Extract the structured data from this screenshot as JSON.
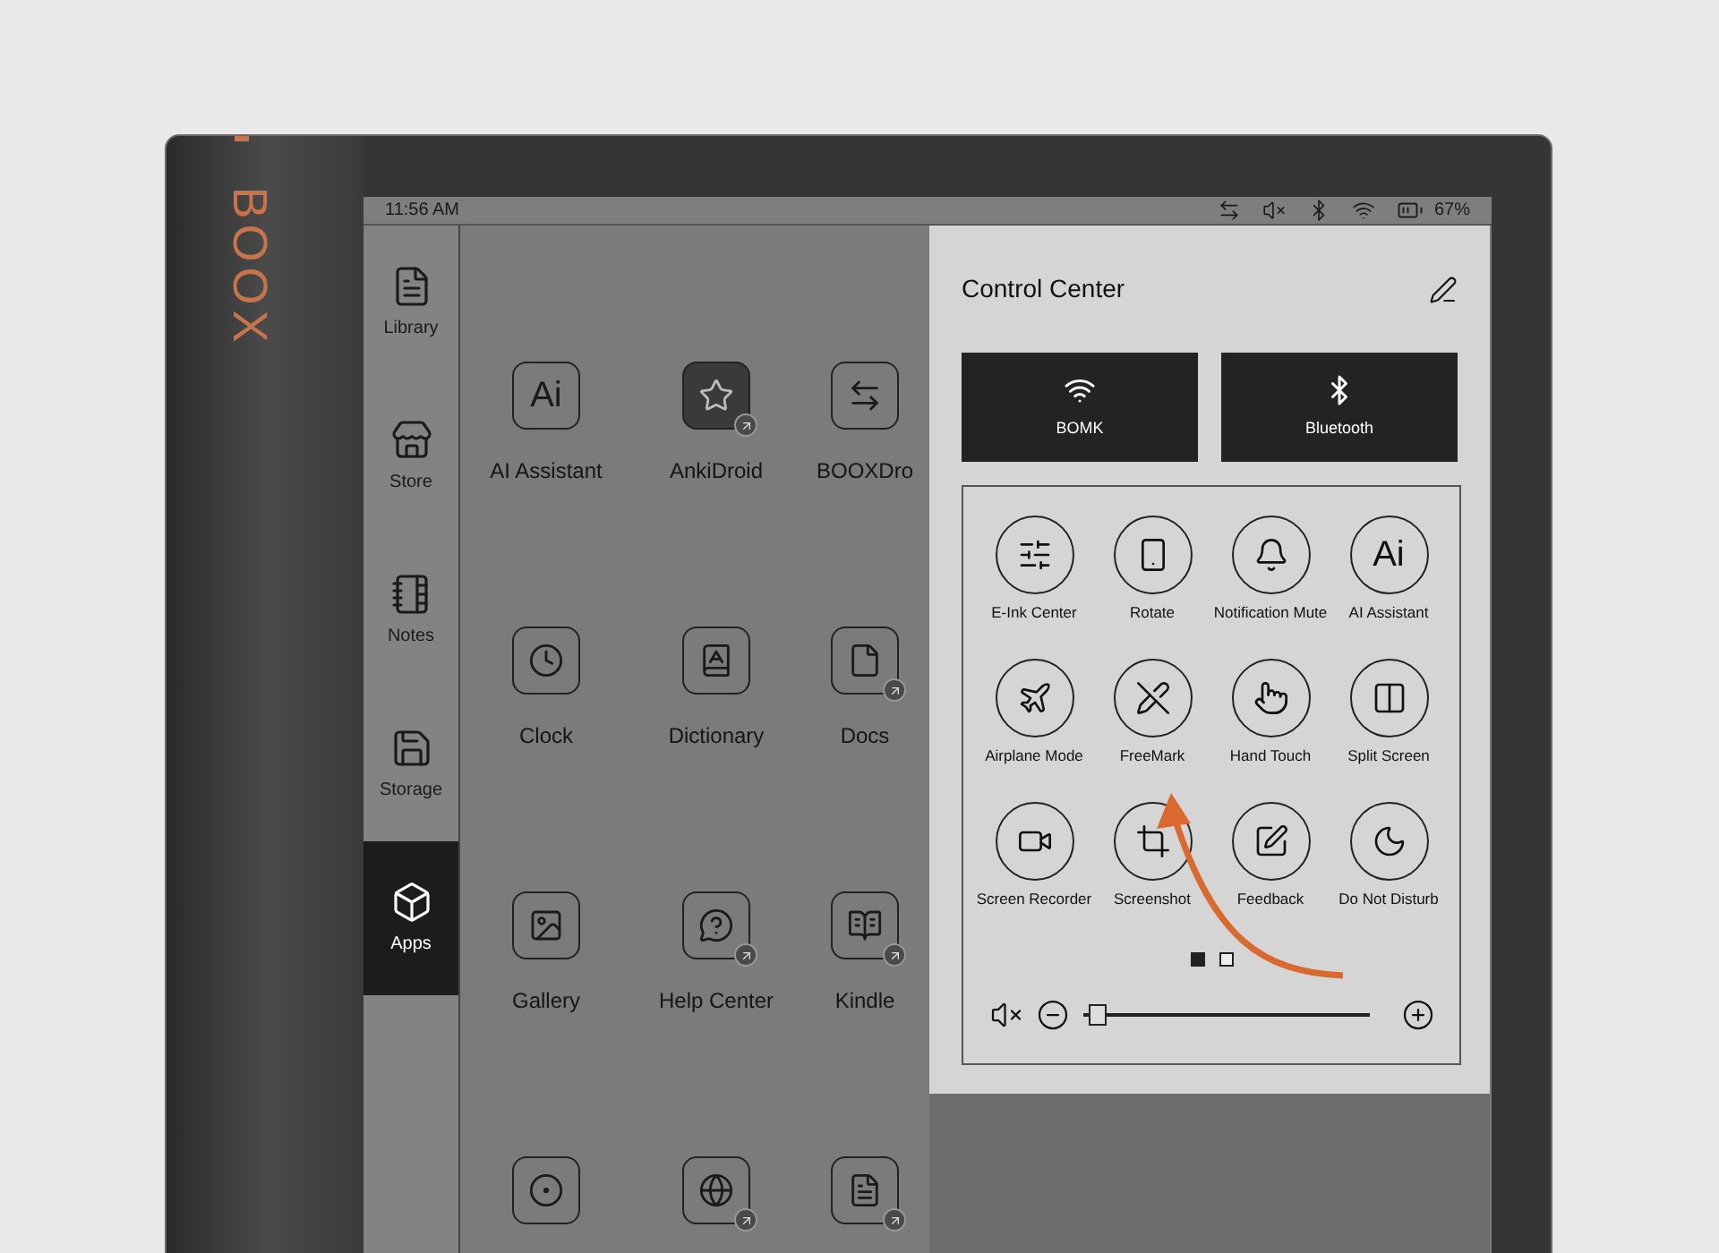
{
  "device": {
    "logo": "BOOX"
  },
  "status_bar": {
    "time": "11:56 AM",
    "battery": "67%"
  },
  "sidebar": {
    "items": [
      {
        "label": "Library",
        "selected": false
      },
      {
        "label": "Store",
        "selected": false
      },
      {
        "label": "Notes",
        "selected": false
      },
      {
        "label": "Storage",
        "selected": false
      },
      {
        "label": "Apps",
        "selected": true
      }
    ]
  },
  "apps": [
    {
      "label": "AI Assistant",
      "glyph": "Ai",
      "shortcut": false,
      "filled": false
    },
    {
      "label": "AnkiDroid",
      "shortcut": true,
      "filled": true
    },
    {
      "label": "BOOXDro",
      "shortcut": false,
      "filled": false
    },
    {
      "label": "Clock",
      "shortcut": false,
      "filled": false
    },
    {
      "label": "Dictionary",
      "shortcut": false,
      "filled": false
    },
    {
      "label": "Docs",
      "shortcut": true,
      "filled": false
    },
    {
      "label": "Gallery",
      "shortcut": false,
      "filled": false
    },
    {
      "label": "Help Center",
      "shortcut": true,
      "filled": false
    },
    {
      "label": "Kindle",
      "shortcut": true,
      "filled": false
    },
    {
      "shortcut": false,
      "filled": false
    },
    {
      "shortcut": true,
      "filled": false
    },
    {
      "shortcut": true,
      "filled": false
    }
  ],
  "control_center": {
    "title": "Control Center",
    "tiles": [
      {
        "label": "BOMK",
        "on": true
      },
      {
        "label": "Bluetooth",
        "on": true
      }
    ],
    "toggles": [
      {
        "label": "E-Ink Center"
      },
      {
        "label": "Rotate"
      },
      {
        "label": "Notification Mute"
      },
      {
        "label": "AI Assistant",
        "glyph": "Ai"
      },
      {
        "label": "Airplane Mode"
      },
      {
        "label": "FreeMark"
      },
      {
        "label": "Hand Touch"
      },
      {
        "label": "Split Screen"
      },
      {
        "label": "Screen Recorder"
      },
      {
        "label": "Screenshot"
      },
      {
        "label": "Feedback"
      },
      {
        "label": "Do Not Disturb"
      }
    ],
    "pages": [
      {
        "selected": true
      },
      {
        "selected": false
      }
    ],
    "volume": {
      "level": 0.02
    }
  }
}
